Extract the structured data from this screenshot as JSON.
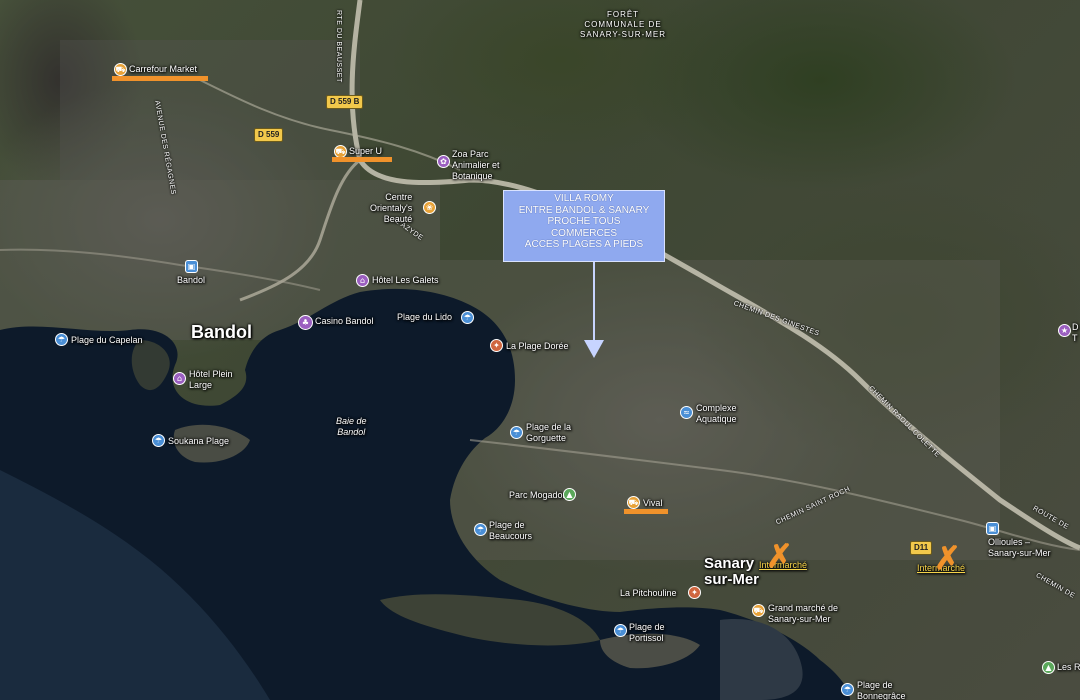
{
  "map": {
    "forest_label": [
      "FORÊT",
      "COMMUNALE DE",
      "SANARY-SUR-MER"
    ],
    "towns": {
      "bandol": "Bandol",
      "sanary": "Sanary\nsur-Mer"
    },
    "bay_label": [
      "Baie de",
      "Bandol"
    ],
    "road_badges": {
      "d559b": "D 559 B",
      "d559": "D 559",
      "d11": "D11"
    },
    "road_names": {
      "beausset": "RTE DU BEAUSSET",
      "regagnes": "AVENUE DES RÉGAGNES",
      "giniestes": "CHEMIN DES GINESTES",
      "colette": "CHEMIN RAOUL COLETTE",
      "saint_roch": "CHEMIN SAINT ROCH",
      "la_route": "ROUTE DE",
      "chemin_de": "CHEMIN DE",
      "lazyde": "L'AZYDE"
    },
    "places": {
      "carrefour": "Carrefour Market",
      "super_u": "Super U",
      "zoa": [
        "Zoa Parc",
        "Animalier et",
        "Botanique"
      ],
      "centre": [
        "Centre",
        "Orientaly's",
        "Beauté"
      ],
      "bandol_station": "Bandol",
      "hotel_galets": "Hôtel Les Galets",
      "casino": "Casino Bandol",
      "plage_lido": "Plage du Lido",
      "plage_capelan": "Plage du Capelan",
      "hotel_plein": [
        "Hôtel Plein",
        "Large"
      ],
      "plage_doree": "La Plage Dorée",
      "complexe": [
        "Complexe",
        "Aquatique"
      ],
      "gorguette": [
        "Plage de la",
        "Gorguette"
      ],
      "soukana": "Soukana Plage",
      "mogador": "Parc Mogador",
      "vival": "Vival",
      "beaucours": [
        "Plage de",
        "Beaucours"
      ],
      "pitchouline": "La Pitchouline",
      "portissol": [
        "Plage de",
        "Portissol"
      ],
      "grand_marche": [
        "Grand marché de",
        "Sanary-sur-Mer"
      ],
      "intermarche1": "Intermarché",
      "intermarche2": "Intermarché",
      "ollioules": [
        "Ollioules –",
        "Sanary-sur-Mer"
      ],
      "bonnegrace": [
        "Plage de",
        "Bonnegrâce"
      ],
      "les_r": "Les R",
      "d_edge": [
        "D",
        "T"
      ]
    },
    "callout": [
      "VILLA ROMY",
      "ENTRE BANDOL & SANARY",
      "PROCHE TOUS",
      "COMMERCES",
      "ACCES PLAGES A PIEDS"
    ],
    "crosses": [
      "✗",
      "✗"
    ],
    "colors": {
      "accent": "#f0922b",
      "callout_bg": "#8fa9ef",
      "sea": "#0b1726",
      "purple_pin": "#9b5fc0",
      "blue_pin": "#4a8fd6",
      "food_pin": "#e8a238",
      "red_pin": "#d0663f",
      "green_pin": "#5aa75a"
    }
  }
}
